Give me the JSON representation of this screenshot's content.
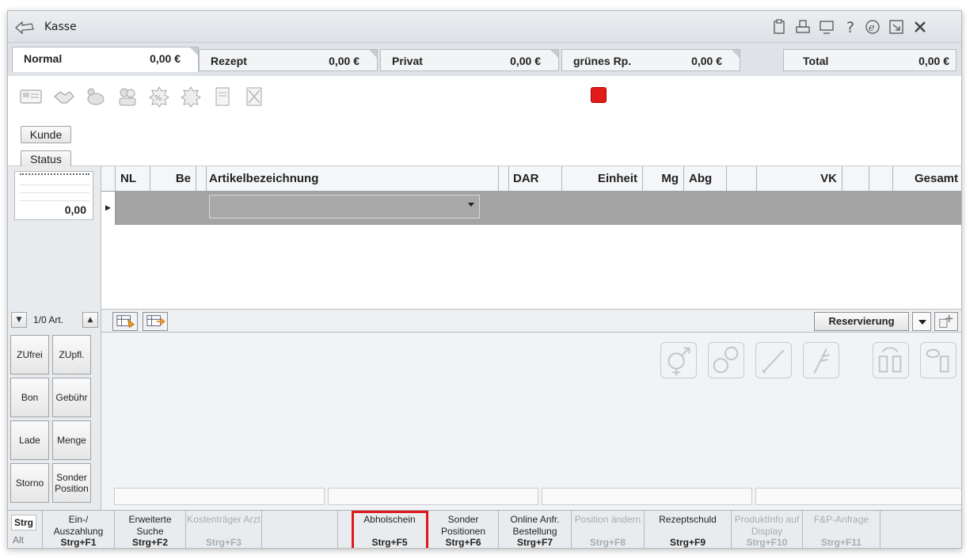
{
  "window": {
    "title": "Kasse"
  },
  "baskets": [
    {
      "label": "Normal",
      "amount": "0,00 €"
    },
    {
      "label": "Rezept",
      "amount": "0,00 €"
    },
    {
      "label": "Privat",
      "amount": "0,00 €"
    },
    {
      "label": "grünes Rp.",
      "amount": "0,00 €"
    }
  ],
  "total": {
    "label": "Total",
    "amount": "0,00 €"
  },
  "toolbar": {
    "kunde": "Kunde",
    "status": "Status"
  },
  "notepad": {
    "value": "0,00"
  },
  "grid": {
    "columns": [
      "NL",
      "Be",
      "Artikelbezeichnung",
      "DAR",
      "Einheit",
      "Mg",
      "Abg",
      "VK",
      "Gesamt"
    ]
  },
  "nav": {
    "article_count": "1/0 Art."
  },
  "reservation": {
    "label": "Reservierung"
  },
  "side_buttons": [
    {
      "label": "ZUfrei"
    },
    {
      "label": "ZUpfl."
    },
    {
      "label": "Bon"
    },
    {
      "label": "Gebühr"
    },
    {
      "label": "Lade"
    },
    {
      "label": "Menge"
    },
    {
      "label": "Storno"
    },
    {
      "label": "Sonder Position"
    }
  ],
  "modifiers": {
    "primary": "Strg",
    "secondary": "Alt"
  },
  "fkeys": [
    {
      "label": "Ein-/ Auszahlung",
      "key": "Strg+F1"
    },
    {
      "label": "Erweiterte Suche",
      "key": "Strg+F2"
    },
    {
      "label": "Kostenträger Arzt",
      "key": "Strg+F3"
    },
    {
      "label": "",
      "key": ""
    },
    {
      "label": "Abholschein",
      "key": "Strg+F5"
    },
    {
      "label": "Sonder Positionen",
      "key": "Strg+F6"
    },
    {
      "label": "Online Anfr. Bestellung",
      "key": "Strg+F7"
    },
    {
      "label": "Position ändern",
      "key": "Strg+F8"
    },
    {
      "label": "Rezeptschuld",
      "key": "Strg+F9"
    },
    {
      "label": "ProduktInfo auf Display",
      "key": "Strg+F10"
    },
    {
      "label": "F&P-Anfrage",
      "key": "Strg+F11"
    }
  ],
  "colors": {
    "highlight": "#e0161a",
    "stop": "#e31a1a"
  }
}
